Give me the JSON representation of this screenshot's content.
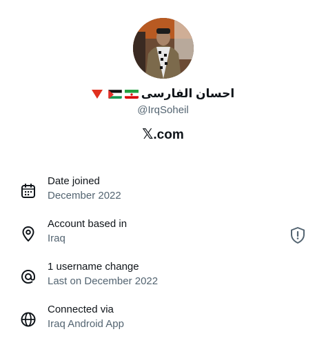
{
  "profile": {
    "display_name": "احسان الفارسی",
    "handle": "@IrqSoheil",
    "emoji_flags": [
      "iran-flag",
      "palestine-flag"
    ],
    "badge": "red-triangle-down"
  },
  "brand": {
    "x_glyph": "𝕏",
    "domain": ".com"
  },
  "details": [
    {
      "icon": "calendar-icon",
      "title": "Date joined",
      "value": "December 2022"
    },
    {
      "icon": "location-pin-icon",
      "title": "Account based in",
      "value": "Iraq",
      "trailing_icon": "shield-alert-icon"
    },
    {
      "icon": "at-sign-icon",
      "title": "1 username change",
      "value": "Last on December 2022"
    },
    {
      "icon": "globe-icon",
      "title": "Connected via",
      "value": "Iraq Android App"
    }
  ],
  "colors": {
    "primary_text": "#0f1419",
    "secondary_text": "#536471",
    "background": "#ffffff"
  }
}
